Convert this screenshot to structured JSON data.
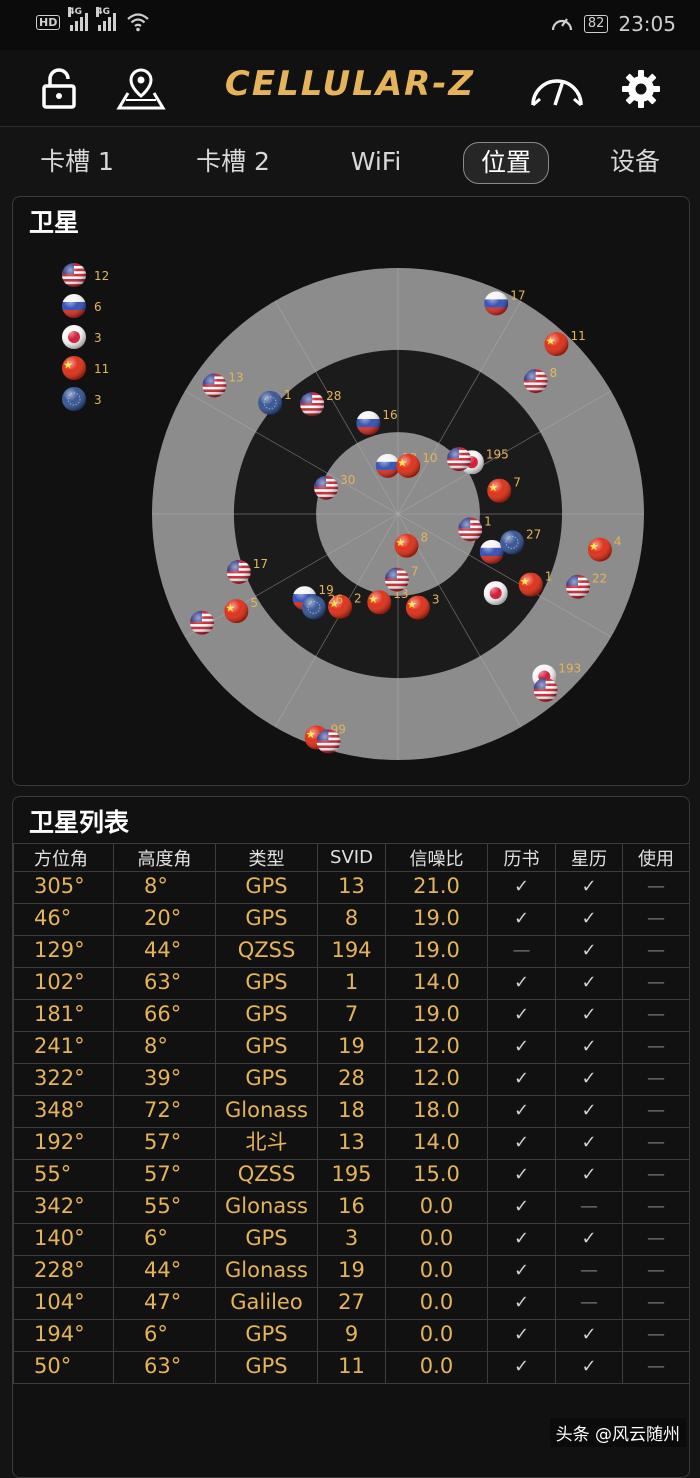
{
  "status_bar": {
    "hd": "HD",
    "net1": "4G",
    "net2": "4G",
    "battery": "82",
    "time": "23:05"
  },
  "header": {
    "app_title": "CELLULAR-Z",
    "icons": [
      "lock-icon",
      "map-pin-icon",
      "speedometer-icon",
      "gear-icon"
    ]
  },
  "tabs": [
    {
      "label": "卡槽 1"
    },
    {
      "label": "卡槽 2"
    },
    {
      "label": "WiFi"
    },
    {
      "label": "位置",
      "active": true
    },
    {
      "label": "设备"
    }
  ],
  "satellite_view": {
    "title": "卫星",
    "legend": [
      {
        "flag": "us",
        "count": "12"
      },
      {
        "flag": "ru",
        "count": "6"
      },
      {
        "flag": "jp",
        "count": "3"
      },
      {
        "flag": "cn",
        "count": "11"
      },
      {
        "flag": "eu",
        "count": "3"
      }
    ],
    "satellites": [
      {
        "flag": "ru",
        "label": "17",
        "az": 25,
        "elev": 5
      },
      {
        "flag": "cn",
        "label": "11",
        "az": 43,
        "elev": 5
      },
      {
        "flag": "us",
        "label": "8",
        "az": 46,
        "elev": 20
      },
      {
        "flag": "eu",
        "label": "1",
        "az": 311,
        "elev": 28
      },
      {
        "flag": "us",
        "label": "13",
        "az": 305,
        "elev": 8
      },
      {
        "flag": "us",
        "label": "28",
        "az": 322,
        "elev": 39
      },
      {
        "flag": "ru",
        "label": "16",
        "az": 342,
        "elev": 55
      },
      {
        "flag": "ru",
        "label": "18",
        "az": 348,
        "elev": 72
      },
      {
        "flag": "cn",
        "label": "10",
        "az": 12,
        "elev": 72
      },
      {
        "flag": "jp",
        "label": "195",
        "az": 55,
        "elev": 57
      },
      {
        "flag": "us",
        "label": "",
        "az": 48,
        "elev": 60
      },
      {
        "flag": "us",
        "label": "30",
        "az": 290,
        "elev": 62
      },
      {
        "flag": "cn",
        "label": "7",
        "az": 77,
        "elev": 52
      },
      {
        "flag": "us",
        "label": "1",
        "az": 102,
        "elev": 63
      },
      {
        "flag": "ru",
        "label": "15",
        "az": 112,
        "elev": 53
      },
      {
        "flag": "eu",
        "label": "27",
        "az": 104,
        "elev": 47
      },
      {
        "flag": "cn",
        "label": "4",
        "az": 100,
        "elev": 15
      },
      {
        "flag": "cn",
        "label": "1",
        "az": 118,
        "elev": 35
      },
      {
        "flag": "jp",
        "label": "",
        "az": 129,
        "elev": 44
      },
      {
        "flag": "us",
        "label": "22",
        "az": 112,
        "elev": 19
      },
      {
        "flag": "jp",
        "label": "193",
        "az": 138,
        "elev": 10
      },
      {
        "flag": "us",
        "label": "",
        "az": 140,
        "elev": 6
      },
      {
        "flag": "us",
        "label": "17",
        "az": 250,
        "elev": 28
      },
      {
        "flag": "cn",
        "label": "5",
        "az": 239,
        "elev": 21
      },
      {
        "flag": "us",
        "label": "",
        "az": 241,
        "elev": 8
      },
      {
        "flag": "ru",
        "label": "19",
        "az": 228,
        "elev": 44
      },
      {
        "flag": "cn",
        "label": "2",
        "az": 212,
        "elev": 50
      },
      {
        "flag": "eu",
        "label": "26",
        "az": 222,
        "elev": 44
      },
      {
        "flag": "cn",
        "label": "13",
        "az": 192,
        "elev": 57
      },
      {
        "flag": "us",
        "label": "7",
        "az": 181,
        "elev": 66
      },
      {
        "flag": "cn",
        "label": "8",
        "az": 165,
        "elev": 78
      },
      {
        "flag": "cn",
        "label": "3",
        "az": 168,
        "elev": 55
      },
      {
        "flag": "cn",
        "label": "99",
        "az": 200,
        "elev": 3
      },
      {
        "flag": "us",
        "label": "",
        "az": 197,
        "elev": 3
      }
    ]
  },
  "satellite_table": {
    "title": "卫星列表",
    "columns": [
      "方位角",
      "高度角",
      "类型",
      "SVID",
      "信噪比",
      "历书",
      "星历",
      "使用"
    ],
    "rows": [
      [
        "305°",
        "8°",
        "GPS",
        "13",
        "21.0",
        "✓",
        "✓",
        "—"
      ],
      [
        "46°",
        "20°",
        "GPS",
        "8",
        "19.0",
        "✓",
        "✓",
        "—"
      ],
      [
        "129°",
        "44°",
        "QZSS",
        "194",
        "19.0",
        "—",
        "✓",
        "—"
      ],
      [
        "102°",
        "63°",
        "GPS",
        "1",
        "14.0",
        "✓",
        "✓",
        "—"
      ],
      [
        "181°",
        "66°",
        "GPS",
        "7",
        "19.0",
        "✓",
        "✓",
        "—"
      ],
      [
        "241°",
        "8°",
        "GPS",
        "19",
        "12.0",
        "✓",
        "✓",
        "—"
      ],
      [
        "322°",
        "39°",
        "GPS",
        "28",
        "12.0",
        "✓",
        "✓",
        "—"
      ],
      [
        "348°",
        "72°",
        "Glonass",
        "18",
        "18.0",
        "✓",
        "✓",
        "—"
      ],
      [
        "192°",
        "57°",
        "北斗",
        "13",
        "14.0",
        "✓",
        "✓",
        "—"
      ],
      [
        "55°",
        "57°",
        "QZSS",
        "195",
        "15.0",
        "✓",
        "✓",
        "—"
      ],
      [
        "342°",
        "55°",
        "Glonass",
        "16",
        "0.0",
        "✓",
        "—",
        "—"
      ],
      [
        "140°",
        "6°",
        "GPS",
        "3",
        "0.0",
        "✓",
        "✓",
        "—"
      ],
      [
        "228°",
        "44°",
        "Glonass",
        "19",
        "0.0",
        "✓",
        "—",
        "—"
      ],
      [
        "104°",
        "47°",
        "Galileo",
        "27",
        "0.0",
        "✓",
        "—",
        "—"
      ],
      [
        "194°",
        "6°",
        "GPS",
        "9",
        "0.0",
        "✓",
        "✓",
        "—"
      ],
      [
        "50°",
        "63°",
        "GPS",
        "11",
        "0.0",
        "✓",
        "✓",
        "—"
      ]
    ]
  },
  "watermark": "头条 @风云随州",
  "colors": {
    "accent": "#e5b45a",
    "background": "#141414",
    "ring_light": "#8c8c8c",
    "ring_dark": "#1b1b1b"
  }
}
